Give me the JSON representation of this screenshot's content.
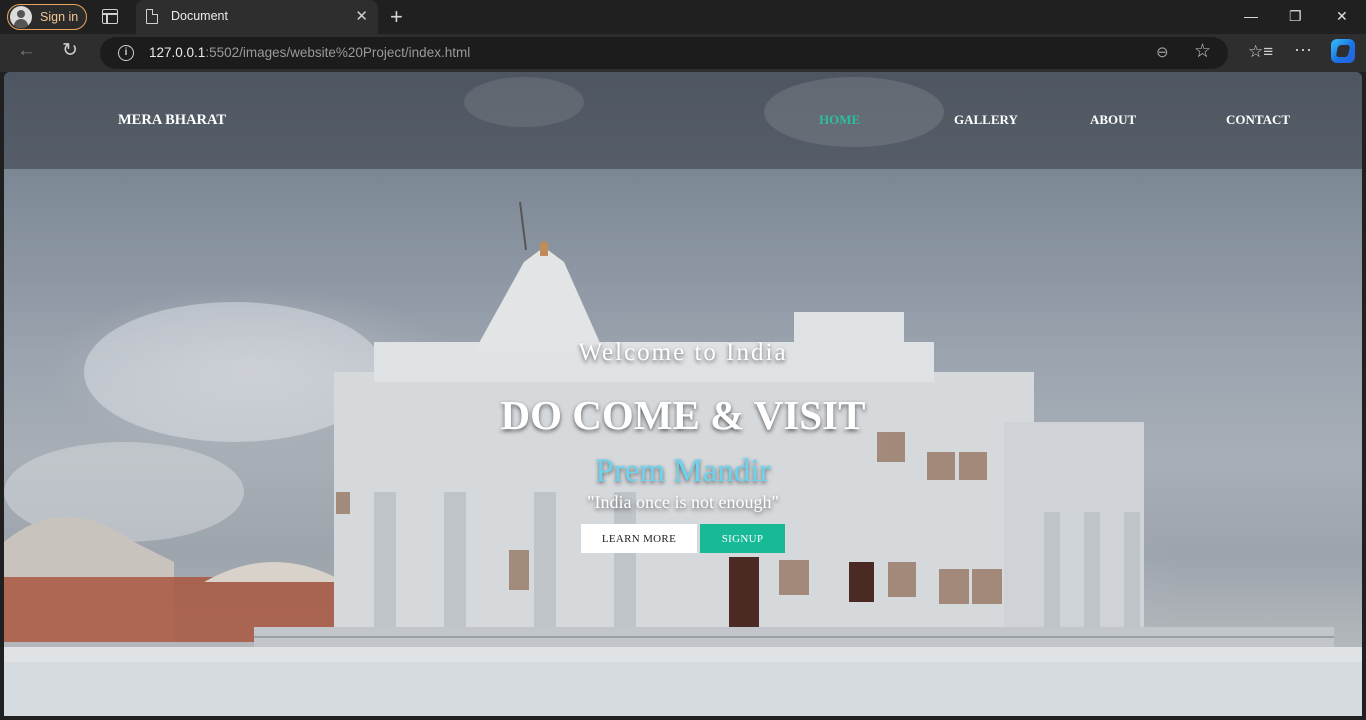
{
  "browser": {
    "signin_label": "Sign in",
    "tab_title": "Document",
    "tab_close": "✕",
    "new_tab": "+",
    "url_host": "127.0.0.1",
    "url_rest": ":5502/images/website%20Project/index.html",
    "window_controls": [
      "—",
      "❐",
      "✕"
    ]
  },
  "site": {
    "brand": "MERA BHARAT",
    "nav": [
      {
        "label": "HOME",
        "active": true
      },
      {
        "label": "GALLERY",
        "active": false
      },
      {
        "label": "ABOUT",
        "active": false
      },
      {
        "label": "CONTACT",
        "active": false
      }
    ],
    "hero": {
      "welcome": "Welcome to India",
      "headline": "DO COME & VISIT",
      "place": "Prem Mandir",
      "quote": "\"India once is not enough\"",
      "learn_more": "LEARN MORE",
      "signup": "SIGNUP"
    },
    "colors": {
      "accent": "#17b996",
      "active_nav": "#2abfa3",
      "place_text": "#6ad4f0"
    }
  }
}
